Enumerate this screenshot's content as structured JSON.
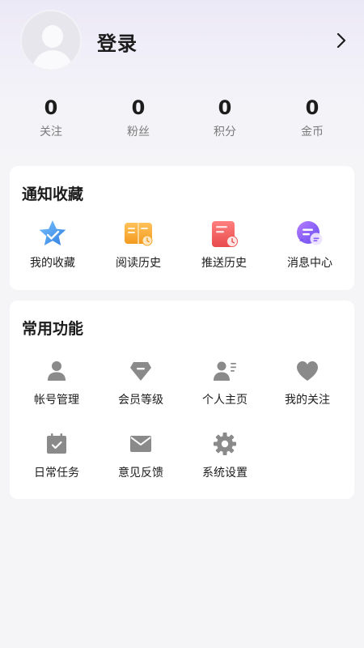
{
  "profile": {
    "login_label": "登录"
  },
  "stats": [
    {
      "value": "0",
      "label": "关注"
    },
    {
      "value": "0",
      "label": "粉丝"
    },
    {
      "value": "0",
      "label": "积分"
    },
    {
      "value": "0",
      "label": "金币"
    }
  ],
  "notify_section": {
    "title": "通知收藏",
    "items": [
      {
        "label": "我的收藏",
        "icon": "star-icon"
      },
      {
        "label": "阅读历史",
        "icon": "book-icon"
      },
      {
        "label": "推送历史",
        "icon": "push-history-icon"
      },
      {
        "label": "消息中心",
        "icon": "message-icon"
      }
    ]
  },
  "common_section": {
    "title": "常用功能",
    "items": [
      {
        "label": "帐号管理",
        "icon": "user-icon"
      },
      {
        "label": "会员等级",
        "icon": "diamond-icon"
      },
      {
        "label": "个人主页",
        "icon": "profile-card-icon"
      },
      {
        "label": "我的关注",
        "icon": "heart-icon"
      },
      {
        "label": "日常任务",
        "icon": "calendar-check-icon"
      },
      {
        "label": "意见反馈",
        "icon": "mail-icon"
      },
      {
        "label": "系统设置",
        "icon": "gear-icon"
      }
    ]
  },
  "colors": {
    "accent_star": "#4a90e2",
    "accent_book": "#f5a623",
    "accent_push": "#f25a5a",
    "accent_message": "#8a5cf6",
    "icon_gray": "#8a8a8a"
  }
}
